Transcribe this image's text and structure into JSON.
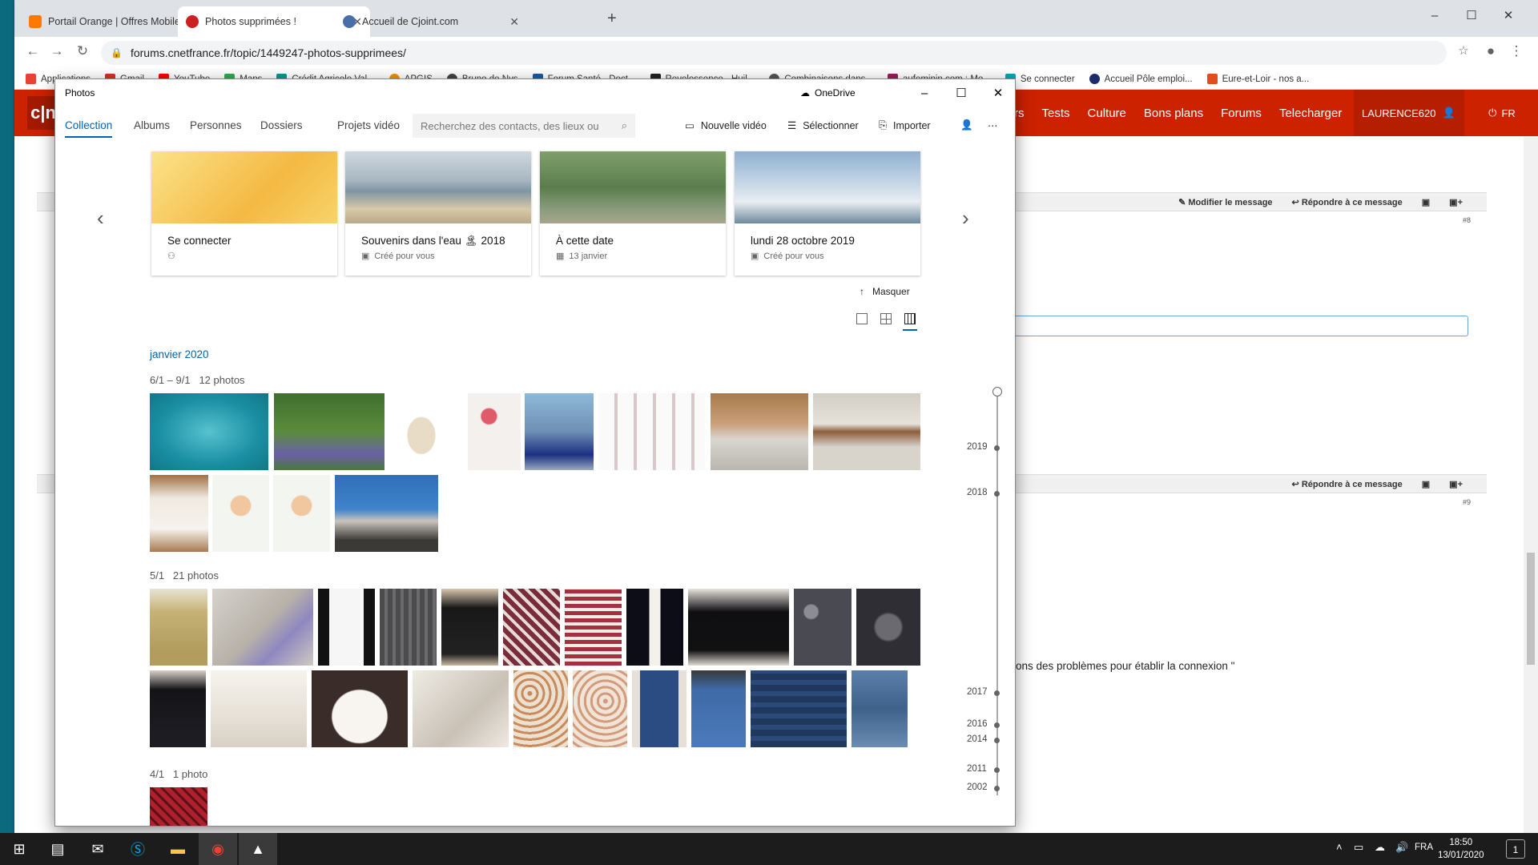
{
  "chrome": {
    "tabs": [
      {
        "title": "Portail Orange | Offres Mobiles, I",
        "color": "#ff7900"
      },
      {
        "title": "Photos supprimées !",
        "color": "#cc1f1f"
      },
      {
        "title": "Accueil de Cjoint.com",
        "color": "#4a6ea9"
      }
    ],
    "url": "forums.cnetfrance.fr/topic/1449247-photos-supprimees/",
    "bookmarks": [
      {
        "label": "Applications",
        "color": "#e94235"
      },
      {
        "label": "Gmail",
        "color": "#d93025"
      },
      {
        "label": "YouTube",
        "color": "#ff0000"
      },
      {
        "label": "Maps",
        "color": "#34a853"
      },
      {
        "label": "Crédit Agricole Val...",
        "color": "#009a92"
      },
      {
        "label": "APGIS",
        "color": "#f29100"
      },
      {
        "label": "Bruno de Nys",
        "color": "#444444"
      },
      {
        "label": "Forum Santé - Doct...",
        "color": "#1a5aa6"
      },
      {
        "label": "Revelessence - Huil...",
        "color": "#222222"
      },
      {
        "label": "Combinaisons dans...",
        "color": "#555555"
      },
      {
        "label": "aufeminin.com : Mo...",
        "color": "#9b1d5a"
      },
      {
        "label": "Se connecter",
        "color": "#00a7b5"
      },
      {
        "label": "Accueil Pôle emploi...",
        "color": "#1c2b6b"
      },
      {
        "label": "Eure-et-Loir - nos a...",
        "color": "#e04e1e"
      }
    ]
  },
  "site": {
    "logo": "c|n",
    "nav": [
      "rs",
      "Tests",
      "Culture",
      "Bons plans",
      "Forums",
      "Telecharger"
    ],
    "user": "LAURENCE620",
    "lang": "FR",
    "msg1": {
      "edit": "Modifier le message",
      "reply": "Répondre à ce message",
      "num": "#8"
    },
    "msg2": {
      "reply": "Répondre à ce message",
      "num": "#9"
    },
    "text": "ons des problèmes pour établir la connexion \""
  },
  "photos": {
    "app_title": "Photos",
    "onedrive": "OneDrive",
    "tabs": [
      "Collection",
      "Albums",
      "Personnes",
      "Dossiers",
      "Projets vidéo"
    ],
    "search_placeholder": "Recherchez des contacts, des lieux ou",
    "actions": {
      "new_video": "Nouvelle vidéo",
      "select": "Sélectionner",
      "import": "Importer"
    },
    "cards": [
      {
        "title": "Se connecter",
        "sub": ""
      },
      {
        "title": "Souvenirs dans l'eau 🏝 2018",
        "sub": "Créé pour vous"
      },
      {
        "title": "À cette date",
        "sub": "13 janvier"
      },
      {
        "title": "lundi 28 octobre 2019",
        "sub": "Créé pour vous"
      }
    ],
    "hide": "Masquer",
    "month": "janvier 2020",
    "groups": [
      {
        "range": "6/1 – 9/1",
        "count": "12 photos"
      },
      {
        "range": "5/1",
        "count": "21 photos"
      },
      {
        "range": "4/1",
        "count": "1 photo"
      }
    ],
    "timeline_years": [
      "2019",
      "2018",
      "2017",
      "2016",
      "2014",
      "2011",
      "2002"
    ]
  },
  "taskbar": {
    "lang": "FRA",
    "time": "18:50",
    "date": "13/01/2020",
    "notif": "1"
  }
}
